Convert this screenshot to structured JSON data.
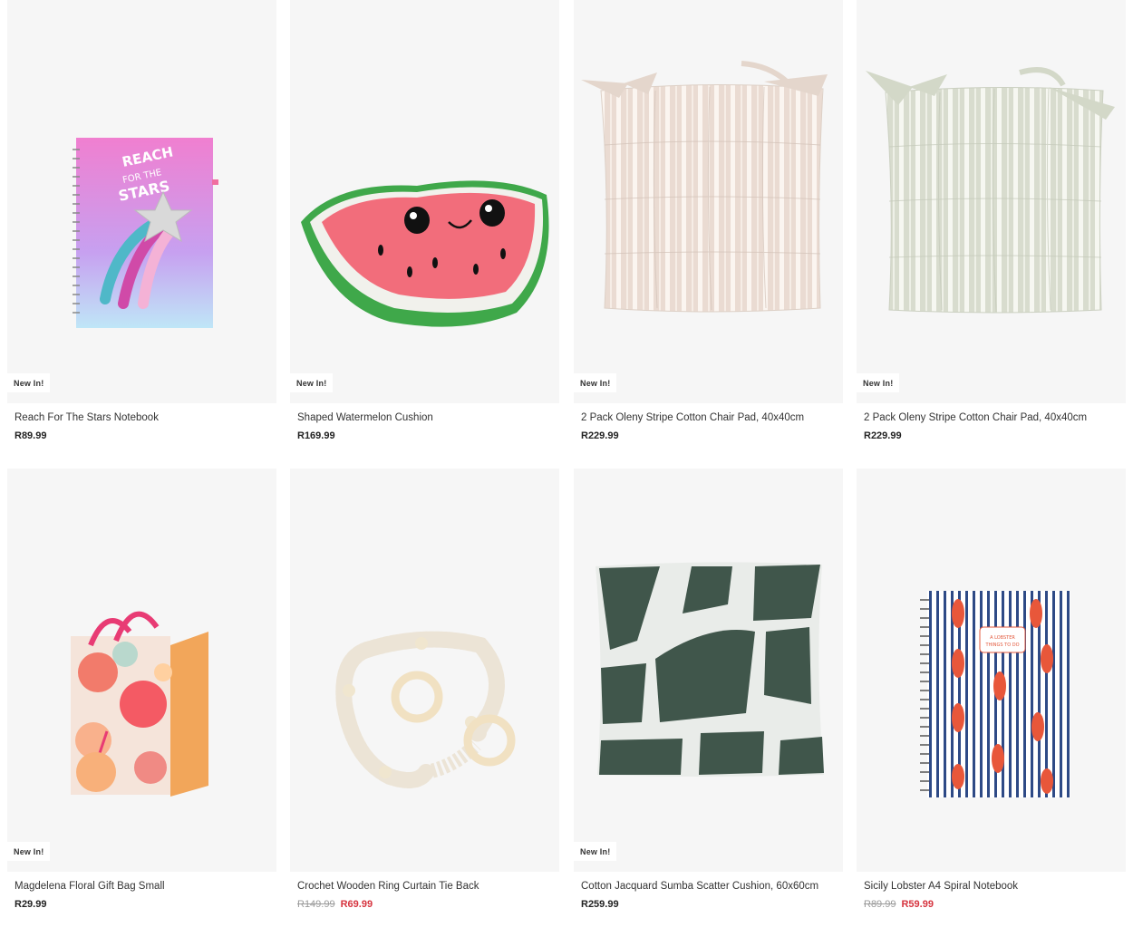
{
  "products": [
    {
      "name": "Reach For The Stars Notebook",
      "price": "R89.99",
      "old_price": "",
      "sale_price": "",
      "badge": "New In!",
      "image_icon": "notebook-stars-image",
      "notebook_text": "REACH FOR THE STARS"
    },
    {
      "name": "Shaped Watermelon Cushion",
      "price": "R169.99",
      "old_price": "",
      "sale_price": "",
      "badge": "New In!",
      "image_icon": "watermelon-cushion-image"
    },
    {
      "name": "2 Pack Oleny Stripe Cotton Chair Pad, 40x40cm",
      "price": "R229.99",
      "old_price": "",
      "sale_price": "",
      "badge": "New In!",
      "image_icon": "beige-chair-pad-image"
    },
    {
      "name": "2 Pack Oleny Stripe Cotton Chair Pad, 40x40cm",
      "price": "R229.99",
      "old_price": "",
      "sale_price": "",
      "badge": "New In!",
      "image_icon": "sage-chair-pad-image"
    },
    {
      "name": "Magdelena Floral Gift Bag Small",
      "price": "R29.99",
      "old_price": "",
      "sale_price": "",
      "badge": "New In!",
      "image_icon": "floral-gift-bag-image"
    },
    {
      "name": "Crochet Wooden Ring Curtain Tie Back",
      "price": "",
      "old_price": "R149.99",
      "sale_price": "R69.99",
      "badge": "",
      "image_icon": "curtain-tie-back-image"
    },
    {
      "name": "Cotton Jacquard Sumba Scatter Cushion, 60x60cm",
      "price": "R259.99",
      "old_price": "",
      "sale_price": "",
      "badge": "New In!",
      "image_icon": "jacquard-cushion-image"
    },
    {
      "name": "Sicily Lobster A4 Spiral Notebook",
      "price": "",
      "old_price": "R89.99",
      "sale_price": "R59.99",
      "badge": "",
      "image_icon": "lobster-notebook-image",
      "notebook_text": "A LOBSTER THINGS TO DO"
    }
  ],
  "colors": {
    "image_bg": "#f6f6f6",
    "sale": "#d6343f",
    "old_price": "#9a9a9a"
  }
}
